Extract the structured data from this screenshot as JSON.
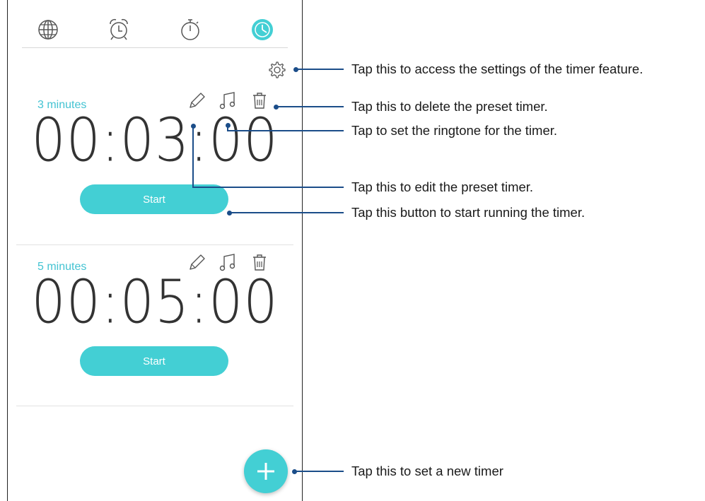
{
  "tabs": [
    {
      "icon": "world-clock-icon"
    },
    {
      "icon": "alarm-icon"
    },
    {
      "icon": "stopwatch-icon"
    },
    {
      "icon": "timer-icon",
      "active": true
    }
  ],
  "settings": {
    "icon": "gear-icon"
  },
  "timers": [
    {
      "label": "3 minutes",
      "display": "00:03:00",
      "start_label": "Start"
    },
    {
      "label": "5 minutes",
      "display": "00:05:00",
      "start_label": "Start"
    }
  ],
  "fab": {
    "icon": "plus-icon"
  },
  "callouts": {
    "settings": "Tap this to access the settings of the timer feature.",
    "delete": "Tap this to delete the preset timer.",
    "ringtone": "Tap to set the ringtone for the timer.",
    "edit": "Tap this to edit the preset timer.",
    "start": "Tap this button to start running the timer.",
    "new_timer": "Tap this to set a new timer"
  },
  "colors": {
    "accent": "#43cfd4",
    "label": "#43c3d2",
    "callout": "#1b4d89"
  }
}
